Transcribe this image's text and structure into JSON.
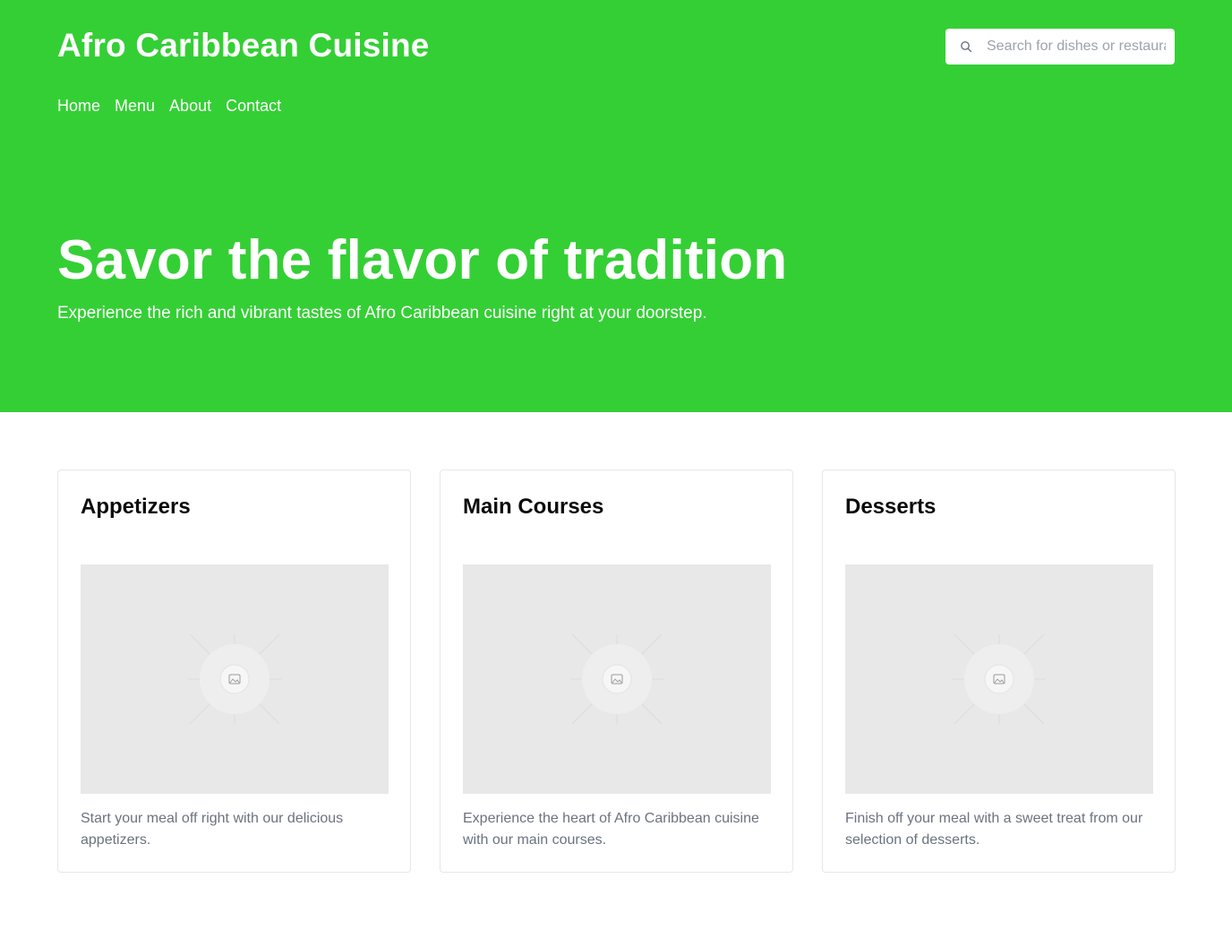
{
  "header": {
    "brand": "Afro Caribbean Cuisine",
    "nav": [
      "Home",
      "Menu",
      "About",
      "Contact"
    ],
    "search": {
      "placeholder": "Search for dishes or restaurants",
      "icon": "search-icon"
    }
  },
  "hero": {
    "title": "Savor the flavor of tradition",
    "subtitle": "Experience the rich and vibrant tastes of Afro Caribbean cuisine right at your doorstep."
  },
  "cards": [
    {
      "title": "Appetizers",
      "description": "Start your meal off right with our delicious appetizers.",
      "image_icon": "image-placeholder-icon"
    },
    {
      "title": "Main Courses",
      "description": "Experience the heart of Afro Caribbean cuisine with our main courses.",
      "image_icon": "image-placeholder-icon"
    },
    {
      "title": "Desserts",
      "description": "Finish off your meal with a sweet treat from our selection of desserts.",
      "image_icon": "image-placeholder-icon"
    }
  ],
  "colors": {
    "hero_bg": "#34cf35",
    "text_muted": "#6b7280",
    "card_border": "#e5e7eb",
    "placeholder_bg": "#e8e8e8"
  }
}
